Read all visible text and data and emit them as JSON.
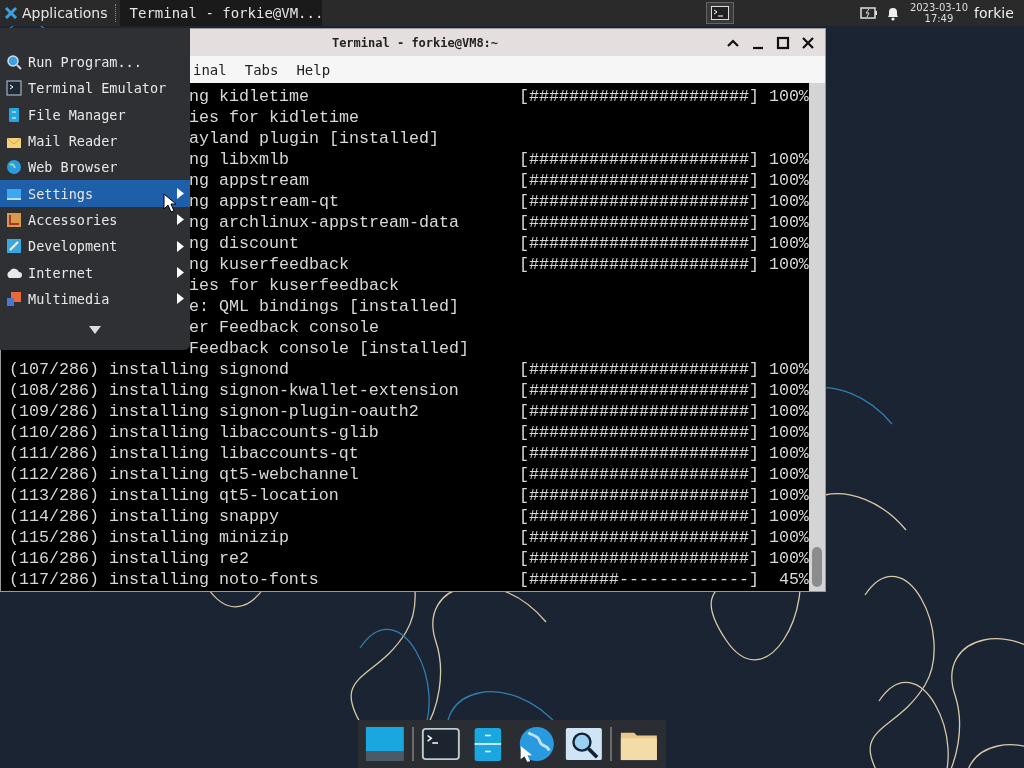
{
  "top_panel": {
    "applications_label": "Applications",
    "task": {
      "title": "Terminal - forkie@VM..."
    },
    "clock": {
      "date": "2023-03-10",
      "time": "17:49"
    },
    "user": "forkie"
  },
  "terminal": {
    "title": "Terminal - forkie@VM8:~",
    "menu": [
      "inal",
      "Tabs",
      "Help"
    ],
    "lines": [
      {
        "kind": "partial",
        "text": "ng kidletime",
        "progress": "[######################] 100%"
      },
      {
        "kind": "partial",
        "text": "ies for kidletime"
      },
      {
        "kind": "partial",
        "text": "ayland plugin [installed]"
      },
      {
        "kind": "partial",
        "text": "ng libxmlb",
        "progress": "[######################] 100%"
      },
      {
        "kind": "partial",
        "text": "ng appstream",
        "progress": "[######################] 100%"
      },
      {
        "kind": "partial",
        "text": "ng appstream-qt",
        "progress": "[######################] 100%"
      },
      {
        "kind": "partial",
        "text": "ng archlinux-appstream-data",
        "progress": "[######################] 100%"
      },
      {
        "kind": "partial",
        "text": "ng discount",
        "progress": "[######################] 100%"
      },
      {
        "kind": "partial",
        "text": "ng kuserfeedback",
        "progress": "[######################] 100%"
      },
      {
        "kind": "partial",
        "text": "ies for kuserfeedback"
      },
      {
        "kind": "partial",
        "text": "e: QML bindings [installed]"
      },
      {
        "kind": "partial",
        "text": "er Feedback console"
      },
      {
        "kind": "partial",
        "text": "Feedback console [installed]"
      },
      {
        "kind": "full",
        "text": "(107/286) installing signond",
        "progress": "[######################] 100%"
      },
      {
        "kind": "full",
        "text": "(108/286) installing signon-kwallet-extension",
        "progress": "[######################] 100%"
      },
      {
        "kind": "full",
        "text": "(109/286) installing signon-plugin-oauth2",
        "progress": "[######################] 100%"
      },
      {
        "kind": "full",
        "text": "(110/286) installing libaccounts-glib",
        "progress": "[######################] 100%"
      },
      {
        "kind": "full",
        "text": "(111/286) installing libaccounts-qt",
        "progress": "[######################] 100%"
      },
      {
        "kind": "full",
        "text": "(112/286) installing qt5-webchannel",
        "progress": "[######################] 100%"
      },
      {
        "kind": "full",
        "text": "(113/286) installing qt5-location",
        "progress": "[######################] 100%"
      },
      {
        "kind": "full",
        "text": "(114/286) installing snappy",
        "progress": "[######################] 100%"
      },
      {
        "kind": "full",
        "text": "(115/286) installing minizip",
        "progress": "[######################] 100%"
      },
      {
        "kind": "full",
        "text": "(116/286) installing re2",
        "progress": "[######################] 100%"
      },
      {
        "kind": "full",
        "text": "(117/286) installing noto-fonts",
        "progress": "[#########-------------]  45%"
      }
    ]
  },
  "app_menu": {
    "items": [
      {
        "label": "Run Program...",
        "kind": "launcher",
        "selected": false
      },
      {
        "label": "Terminal Emulator",
        "kind": "launcher",
        "selected": false
      },
      {
        "label": "File Manager",
        "kind": "launcher",
        "selected": false
      },
      {
        "label": "Mail Reader",
        "kind": "launcher",
        "selected": false
      },
      {
        "label": "Web Browser",
        "kind": "launcher",
        "selected": false
      },
      {
        "label": "Settings",
        "kind": "submenu",
        "selected": true
      },
      {
        "label": "Accessories",
        "kind": "submenu",
        "selected": false
      },
      {
        "label": "Development",
        "kind": "submenu",
        "selected": false
      },
      {
        "label": "Internet",
        "kind": "submenu",
        "selected": false
      },
      {
        "label": "Multimedia",
        "kind": "submenu",
        "selected": false
      }
    ]
  }
}
